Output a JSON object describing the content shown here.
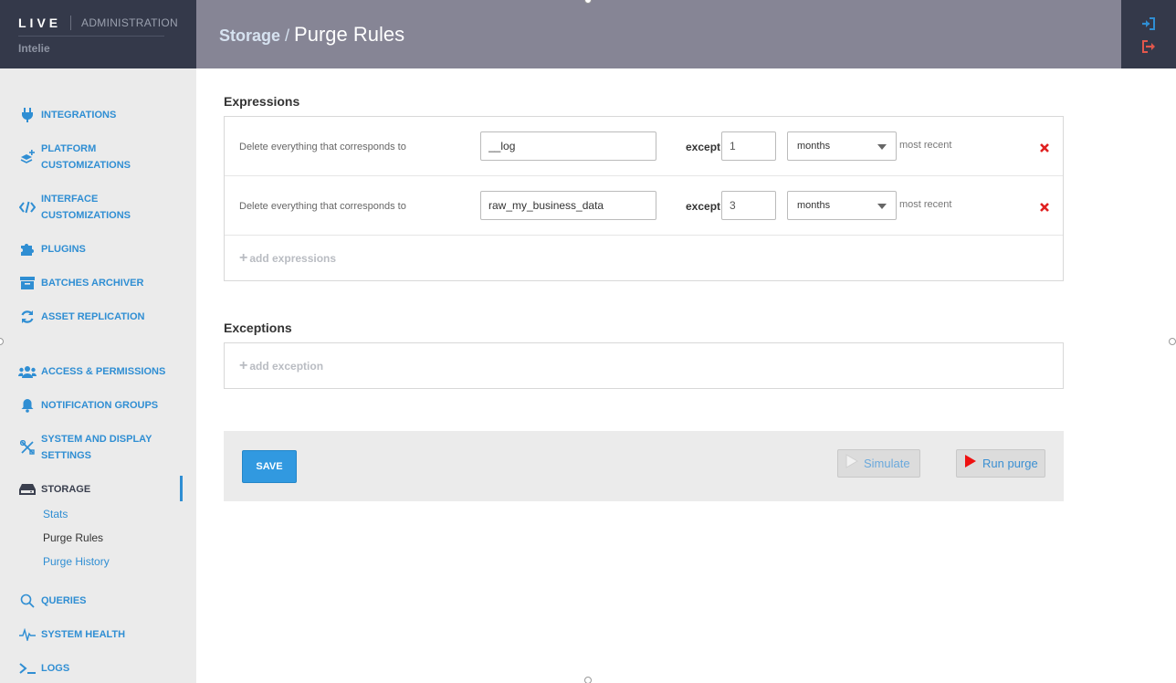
{
  "brand": {
    "logo": "LIVE",
    "section": "ADMINISTRATION",
    "company": "Intelie"
  },
  "header": {
    "breadcrumb_parent": "Storage",
    "breadcrumb_sep": "/",
    "title": "Purge Rules"
  },
  "sidebar": {
    "items": [
      {
        "label": "INTEGRATIONS",
        "icon": "plug-icon"
      },
      {
        "label": "PLATFORM",
        "label2": "CUSTOMIZATIONS",
        "icon": "layers-plus-icon"
      },
      {
        "label": "INTERFACE",
        "label2": "CUSTOMIZATIONS",
        "icon": "code-icon"
      },
      {
        "label": "PLUGINS",
        "icon": "puzzle-icon"
      },
      {
        "label": "BATCHES ARCHIVER",
        "icon": "archive-icon"
      },
      {
        "label": "ASSET REPLICATION",
        "icon": "sync-icon"
      },
      {
        "label": "ACCESS & PERMISSIONS",
        "icon": "users-icon"
      },
      {
        "label": "NOTIFICATION GROUPS",
        "icon": "bell-icon"
      },
      {
        "label": "SYSTEM AND DISPLAY",
        "label2": "SETTINGS",
        "icon": "tools-icon"
      },
      {
        "label": "STORAGE",
        "icon": "storage-icon"
      },
      {
        "label": "QUERIES",
        "icon": "search-icon"
      },
      {
        "label": "SYSTEM HEALTH",
        "icon": "pulse-icon"
      },
      {
        "label": "LOGS",
        "icon": "terminal-icon"
      }
    ],
    "storage_sub": [
      {
        "label": "Stats"
      },
      {
        "label": "Purge Rules"
      },
      {
        "label": "Purge History"
      }
    ]
  },
  "expressions": {
    "title": "Expressions",
    "rows": [
      {
        "text": "Delete everything that corresponds to",
        "expression": "__log",
        "except_label": "except",
        "count": "1",
        "unit": "months",
        "suffix": "most recent"
      },
      {
        "text": "Delete everything that corresponds to",
        "expression": "raw_my_business_data",
        "except_label": "except",
        "count": "3",
        "unit": "months",
        "suffix": "most recent"
      }
    ],
    "add_label": "add expressions"
  },
  "exceptions": {
    "title": "Exceptions",
    "add_label": "add exception"
  },
  "actions": {
    "save": "SAVE",
    "simulate": "Simulate",
    "run": "Run purge"
  },
  "colors": {
    "accent": "#3199e0",
    "sidebar_bg": "#ebebeb",
    "header_bg": "#868595",
    "brand_bg": "#34394a",
    "danger": "#e02020"
  }
}
